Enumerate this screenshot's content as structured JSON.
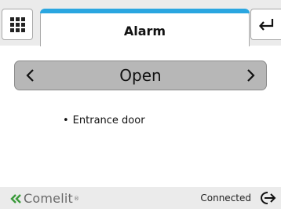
{
  "header": {
    "title": "Alarm"
  },
  "selector": {
    "value": "Open"
  },
  "list": {
    "items": [
      "Entrance door"
    ]
  },
  "footer": {
    "logo_text": "Comelit",
    "logo_mark": "®",
    "status": "Connected"
  },
  "colors": {
    "accent": "#2aa6e0",
    "bar_bg": "#ebebeb",
    "selector_bg": "#b7b7b7",
    "logo_green": "#3a9a3a"
  },
  "icons": {
    "menu": "grid-icon",
    "back": "return-arrow-icon",
    "prev": "chevron-left-icon",
    "next": "chevron-right-icon",
    "logout": "logout-icon"
  }
}
